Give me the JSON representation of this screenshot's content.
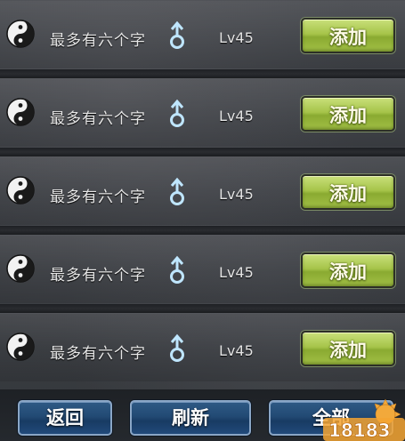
{
  "rows": [
    {
      "name": "最多有六个字",
      "level": "Lv45",
      "add_label": "添加"
    },
    {
      "name": "最多有六个字",
      "level": "Lv45",
      "add_label": "添加"
    },
    {
      "name": "最多有六个字",
      "level": "Lv45",
      "add_label": "添加"
    },
    {
      "name": "最多有六个字",
      "level": "Lv45",
      "add_label": "添加"
    },
    {
      "name": "最多有六个字",
      "level": "Lv45",
      "add_label": "添加"
    }
  ],
  "footer": {
    "back_label": "返回",
    "refresh_label": "刷新",
    "all_label": "全部"
  },
  "watermark": {
    "text": "18183",
    "icon": "sun-logo"
  },
  "colors": {
    "add_button": "#a6c44a",
    "footer_button": "#224a74",
    "gender_icon": "#bfe6ff"
  }
}
